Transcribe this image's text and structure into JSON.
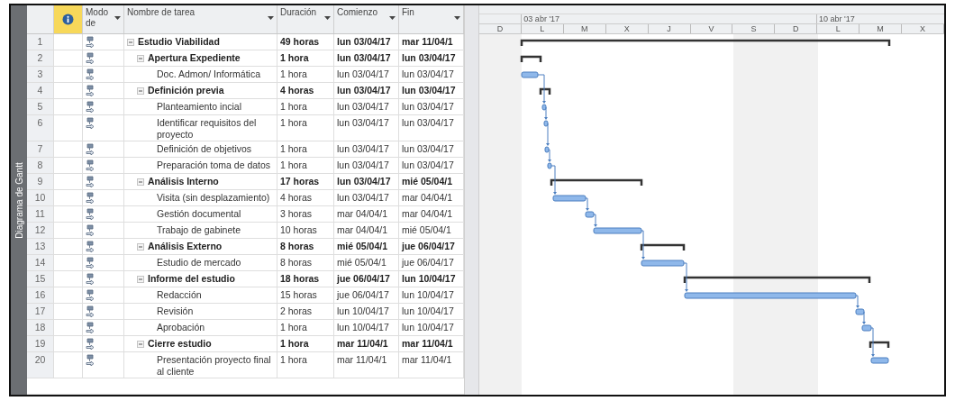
{
  "side_label": "Diagrama de Gantt",
  "columns": [
    {
      "kind": "info",
      "highlighted": true
    },
    {
      "kind": "text",
      "label": "Modo de"
    },
    {
      "kind": "text",
      "label": "Nombre de tarea"
    },
    {
      "kind": "text",
      "label": "Duración"
    },
    {
      "kind": "text",
      "label": "Comienzo"
    },
    {
      "kind": "text",
      "label": "Fin"
    }
  ],
  "timescale": {
    "days": [
      {
        "label": "D",
        "nonworking": true
      },
      {
        "label": "L",
        "nonworking": false,
        "week": "03 abr '17"
      },
      {
        "label": "M",
        "nonworking": false
      },
      {
        "label": "X",
        "nonworking": false
      },
      {
        "label": "J",
        "nonworking": false
      },
      {
        "label": "V",
        "nonworking": false
      },
      {
        "label": "S",
        "nonworking": true
      },
      {
        "label": "D",
        "nonworking": true
      },
      {
        "label": "L",
        "nonworking": false,
        "week": "10 abr '17"
      },
      {
        "label": "M",
        "nonworking": false
      },
      {
        "label": "X",
        "nonworking": false
      }
    ]
  },
  "tasks": [
    {
      "id": "1",
      "name": "Estudio Viabilidad",
      "duration": "49 horas",
      "start": "lun 03/04/17",
      "finish": "mar 11/04/1",
      "expanded": true,
      "children": [
        {
          "id": "2",
          "name": "Apertura Expediente",
          "duration": "1 hora",
          "start": "lun 03/04/17",
          "finish": "lun 03/04/17",
          "expanded": true,
          "children": [
            {
              "id": "3",
              "name": "Doc. Admon/ Informática",
              "duration": "1 hora",
              "start": "lun 03/04/17",
              "finish": "lun 03/04/17"
            }
          ]
        },
        {
          "id": "4",
          "name": "Definición previa",
          "duration": "4 horas",
          "start": "lun 03/04/17",
          "finish": "lun 03/04/17",
          "expanded": true,
          "children": [
            {
              "id": "5",
              "name": "Planteamiento incial",
              "duration": "1 hora",
              "start": "lun 03/04/17",
              "finish": "lun 03/04/17"
            },
            {
              "id": "6",
              "name": "Identificar requisitos del proyecto",
              "duration": "1 hora",
              "start": "lun 03/04/17",
              "finish": "lun 03/04/17"
            },
            {
              "id": "7",
              "name": "Definición de objetivos",
              "duration": "1 hora",
              "start": "lun 03/04/17",
              "finish": "lun 03/04/17"
            },
            {
              "id": "8",
              "name": "Preparación toma de datos",
              "duration": "1 hora",
              "start": "lun 03/04/17",
              "finish": "lun 03/04/17"
            }
          ]
        },
        {
          "id": "9",
          "name": "Análisis Interno",
          "duration": "17 horas",
          "start": "lun 03/04/17",
          "finish": "mié 05/04/1",
          "expanded": true,
          "children": [
            {
              "id": "10",
              "name": "Visita (sin desplazamiento)",
              "duration": "4 horas",
              "start": "lun 03/04/17",
              "finish": "mar 04/04/1"
            },
            {
              "id": "11",
              "name": "Gestión documental",
              "duration": "3 horas",
              "start": "mar 04/04/1",
              "finish": "mar 04/04/1"
            },
            {
              "id": "12",
              "name": "Trabajo de gabinete",
              "duration": "10 horas",
              "start": "mar 04/04/1",
              "finish": "mié 05/04/1"
            }
          ]
        },
        {
          "id": "13",
          "name": "Análisis Externo",
          "duration": "8 horas",
          "start": "mié 05/04/1",
          "finish": "jue 06/04/17",
          "expanded": true,
          "children": [
            {
              "id": "14",
              "name": "Estudio de mercado",
              "duration": "8 horas",
              "start": "mié 05/04/1",
              "finish": "jue 06/04/17"
            }
          ]
        },
        {
          "id": "15",
          "name": "Informe del estudio",
          "duration": "18 horas",
          "start": "jue 06/04/17",
          "finish": "lun 10/04/17",
          "expanded": true,
          "children": [
            {
              "id": "16",
              "name": "Redacción",
              "duration": "15 horas",
              "start": "jue 06/04/17",
              "finish": "lun 10/04/17"
            },
            {
              "id": "17",
              "name": "Revisión",
              "duration": "2 horas",
              "start": "lun 10/04/17",
              "finish": "lun 10/04/17"
            },
            {
              "id": "18",
              "name": "Aprobación",
              "duration": "1 hora",
              "start": "lun 10/04/17",
              "finish": "lun 10/04/17"
            }
          ]
        },
        {
          "id": "19",
          "name": "Cierre estudio",
          "duration": "1 hora",
          "start": "mar 11/04/1",
          "finish": "mar 11/04/1",
          "expanded": true,
          "children": [
            {
              "id": "20",
              "name": "Presentación proyecto final al cliente",
              "duration": "1 hora",
              "start": "mar 11/04/1",
              "finish": "mar 11/04/1"
            }
          ]
        }
      ]
    }
  ]
}
